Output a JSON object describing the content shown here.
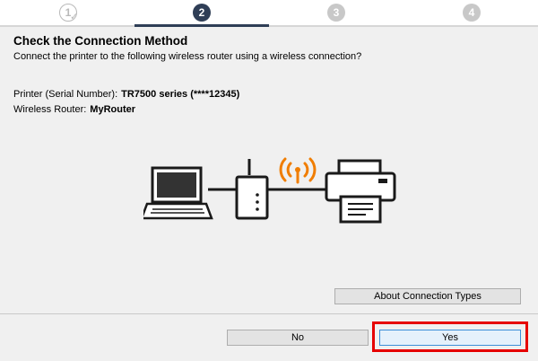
{
  "steps": {
    "step1": "1",
    "step2": "2",
    "step3": "3",
    "step4": "4"
  },
  "header": {
    "title": "Check the Connection Method",
    "subtitle": "Connect the printer to the following wireless router using a wireless connection?"
  },
  "info": {
    "printer_label": "Printer (Serial Number):",
    "printer_value": "TR7500 series (****12345)",
    "router_label": "Wireless Router:",
    "router_value": "MyRouter"
  },
  "buttons": {
    "about": "About Connection Types",
    "no": "No",
    "yes": "Yes"
  },
  "colors": {
    "step_active": "#2f3e56",
    "wifi": "#f07d00",
    "highlight": "#e60000"
  }
}
